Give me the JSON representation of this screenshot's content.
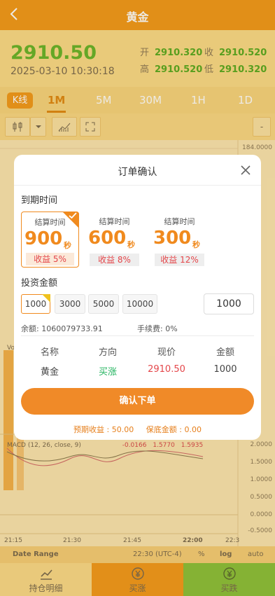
{
  "header": {
    "title": "黄金",
    "back_icon": "chevron-left-icon"
  },
  "price": {
    "current": "2910.50",
    "datetime": "2025-03-10 10:30:18",
    "open_label": "开",
    "open_value": "2910.320",
    "close_label": "收",
    "close_value": "2910.520",
    "high_label": "高",
    "high_value": "2910.520",
    "low_label": "低",
    "low_value": "2910.320"
  },
  "tabs": {
    "kline": "K线",
    "items": [
      "1M",
      "5M",
      "30M",
      "1H",
      "1D"
    ],
    "active": "1M"
  },
  "chart": {
    "price_axis_top": "184.0000",
    "macd_label": "MACD (12, 26, close, 9)",
    "macd_values": [
      "-0.0166",
      "1.5770",
      "1.5935"
    ],
    "macd_axis": [
      "2.0000",
      "1.5000",
      "1.0000",
      "0.5000",
      "0.0000",
      "-0.5000"
    ],
    "time_labels": [
      "21:15",
      "21:30",
      "21:45",
      "22:00",
      "22:3"
    ],
    "range_label": "Date Range",
    "timezone": "22:30 (UTC-4)",
    "pct_label": "%",
    "log_label": "log",
    "auto_label": "auto",
    "vol_label": "Vo"
  },
  "modal": {
    "title": "订单确认",
    "expiry_section": "到期时间",
    "options": [
      {
        "label": "结算时间",
        "seconds": "900",
        "unit": "秒",
        "profit": "收益 5%",
        "selected": true
      },
      {
        "label": "结算时间",
        "seconds": "600",
        "unit": "秒",
        "profit": "收益 8%",
        "selected": false
      },
      {
        "label": "结算时间",
        "seconds": "300",
        "unit": "秒",
        "profit": "收益 12%",
        "selected": false
      }
    ],
    "amount_section": "投资金额",
    "amounts": [
      "1000",
      "3000",
      "5000",
      "10000"
    ],
    "amount_input": "1000",
    "balance_label": "余额:",
    "balance_value": "1060079733.91",
    "fee_label": "手续费:",
    "fee_value": "0%",
    "table_headers": [
      "名称",
      "方向",
      "现价",
      "金额"
    ],
    "table_row": [
      "黄金",
      "买涨",
      "2910.50",
      "1000"
    ],
    "confirm_button": "确认下单",
    "expected_profit": "预期收益 : 50.00",
    "margin": "保底金额 : 0.00"
  },
  "bottom_bar": {
    "holdings": "持仓明细",
    "buy_up": "买涨",
    "buy_down": "买跌"
  },
  "colors": {
    "orange": "#f29a1b",
    "green": "#68b52b",
    "red": "#e4464a",
    "buy_up_bg": "#f39a1c",
    "buy_down_bg": "#8cc13a"
  }
}
